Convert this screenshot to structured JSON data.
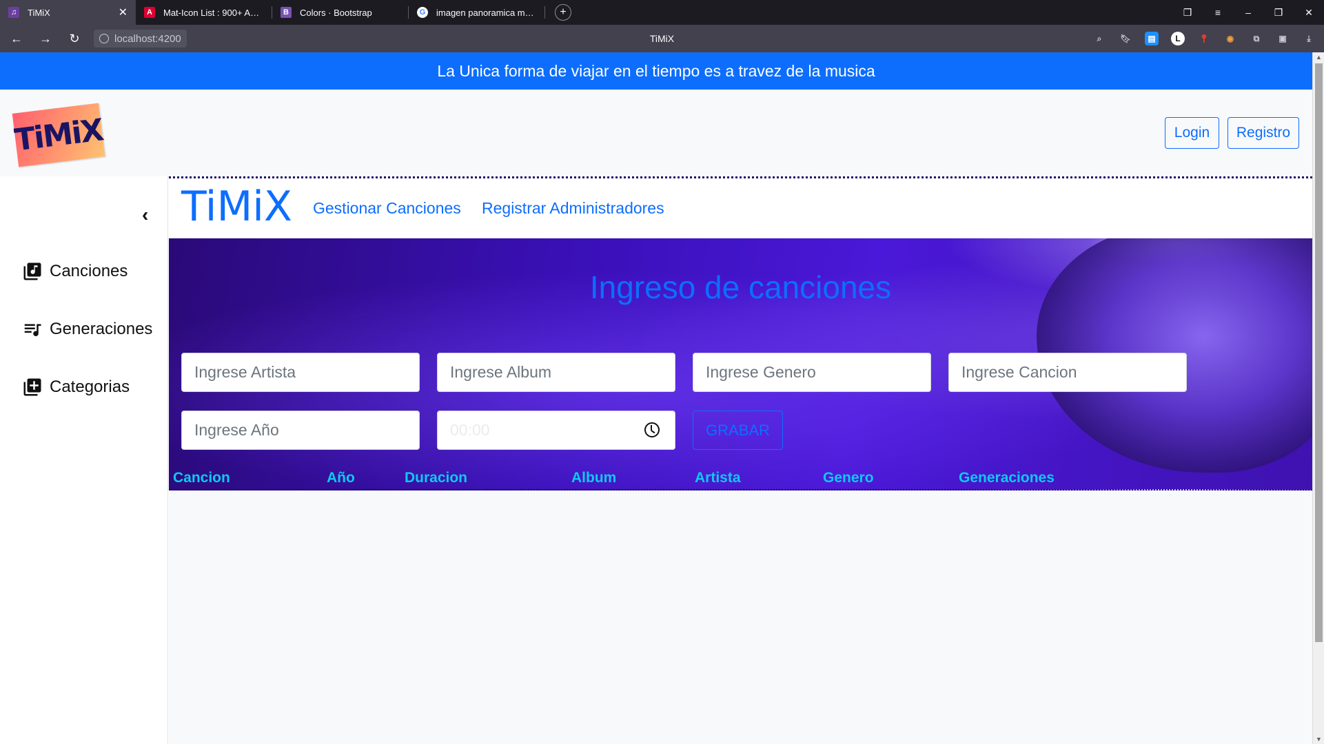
{
  "browser": {
    "tabs": [
      {
        "title": "TiMiX",
        "favicon_color": "#6b3fa0",
        "favicon_text": "",
        "active": true
      },
      {
        "title": "Mat-Icon List : 900+ Angul",
        "favicon_color": "#dd0031",
        "favicon_text": "A",
        "active": false
      },
      {
        "title": "Colors · Bootstrap",
        "favicon_color": "#7952b3",
        "favicon_text": "B",
        "active": false
      },
      {
        "title": "imagen panoramica music",
        "favicon_color": "#ffffff",
        "favicon_text": "G",
        "active": false
      }
    ],
    "url": "localhost:4200",
    "window_title": "TiMiX"
  },
  "banner": {
    "text": "La Unica forma de viajar en el tiempo es a travez de la musica"
  },
  "header": {
    "logo_text": "TiMiX",
    "login_label": "Login",
    "register_label": "Registro"
  },
  "sidebar": {
    "collapse_icon": "chevron-left-icon",
    "items": [
      {
        "label": "Canciones",
        "icon": "library-music-icon"
      },
      {
        "label": "Generaciones",
        "icon": "queue-music-icon"
      },
      {
        "label": "Categorias",
        "icon": "library-add-icon"
      }
    ]
  },
  "subnav": {
    "brand": "TiMiX",
    "links": [
      "Gestionar Canciones",
      "Registrar Administradores"
    ]
  },
  "form": {
    "title": "Ingreso de canciones",
    "placeholders": {
      "artista": "Ingrese Artista",
      "album": "Ingrese Album",
      "genero": "Ingrese Genero",
      "cancion": "Ingrese Cancion",
      "anio": "Ingrese Año",
      "duracion": "00:00"
    },
    "submit_label": "GRABAR"
  },
  "table": {
    "columns": [
      "Cancion",
      "Año",
      "Duracion",
      "Album",
      "Artista",
      "Genero",
      "Generaciones"
    ]
  },
  "colors": {
    "primary": "#0d6efd",
    "info": "#0dcaf0",
    "dark_navy": "#1b1464"
  }
}
